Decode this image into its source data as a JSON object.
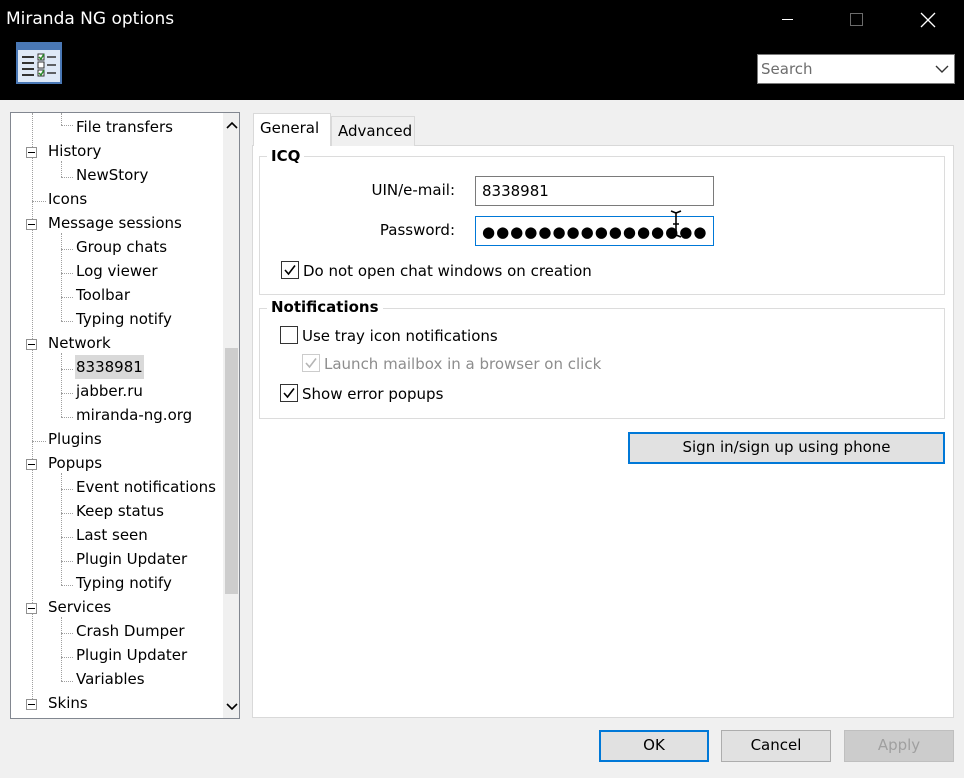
{
  "window": {
    "title": "Miranda NG options"
  },
  "search": {
    "placeholder": "Search"
  },
  "tree": {
    "items": [
      {
        "label": "File transfers"
      },
      {
        "label": "History"
      },
      {
        "label": "NewStory"
      },
      {
        "label": "Icons"
      },
      {
        "label": "Message sessions"
      },
      {
        "label": "Group chats"
      },
      {
        "label": "Log viewer"
      },
      {
        "label": "Toolbar"
      },
      {
        "label": "Typing notify"
      },
      {
        "label": "Network"
      },
      {
        "label": "8338981"
      },
      {
        "label": "jabber.ru"
      },
      {
        "label": "miranda-ng.org"
      },
      {
        "label": "Plugins"
      },
      {
        "label": "Popups"
      },
      {
        "label": "Event notifications"
      },
      {
        "label": "Keep status"
      },
      {
        "label": "Last seen"
      },
      {
        "label": "Plugin Updater"
      },
      {
        "label": "Typing notify"
      },
      {
        "label": "Services"
      },
      {
        "label": "Crash Dumper"
      },
      {
        "label": "Plugin Updater"
      },
      {
        "label": "Variables"
      },
      {
        "label": "Skins"
      }
    ],
    "selected": "8338981"
  },
  "tabs": [
    {
      "label": "General",
      "active": true
    },
    {
      "label": "Advanced",
      "active": false
    }
  ],
  "icq": {
    "legend": "ICQ",
    "uin_label": "UIN/e-mail:",
    "uin_value": "8338981",
    "password_label": "Password:",
    "password_mask": "●●●●●●●●●●●●●●●●",
    "no_chat_windows": {
      "label": "Do not open chat windows on creation",
      "checked": true
    }
  },
  "notifications": {
    "legend": "Notifications",
    "tray_icon": {
      "label": "Use tray icon notifications",
      "checked": false
    },
    "launch_mailbox": {
      "label": "Launch mailbox in a browser on click",
      "checked": true,
      "disabled": true
    },
    "error_popups": {
      "label": "Show error popups",
      "checked": true
    }
  },
  "phone_button": {
    "label": "Sign in/sign up using phone"
  },
  "footer": {
    "ok": "OK",
    "cancel": "Cancel",
    "apply": "Apply"
  },
  "colors": {
    "accent": "#0078d7",
    "title_bar": "#000000",
    "selection": "#d9d9d9"
  }
}
